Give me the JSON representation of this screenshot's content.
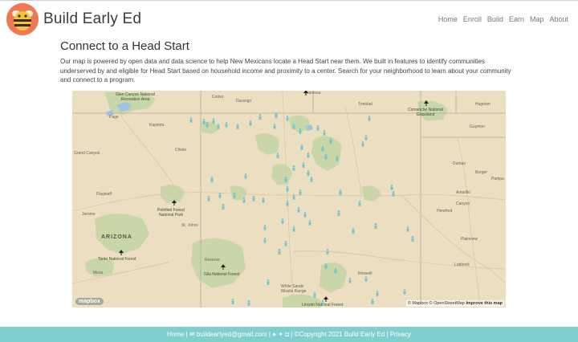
{
  "brand": {
    "name": "Build Early Ed"
  },
  "nav": [
    {
      "label": "Home"
    },
    {
      "label": "Enroll"
    },
    {
      "label": "Build"
    },
    {
      "label": "Earn"
    },
    {
      "label": "Map"
    },
    {
      "label": "About"
    }
  ],
  "main": {
    "title": "Connect to a Head Start",
    "intro": "Our map is powered by open data and data science to help New Mexicans locate a Head Start near them. We built in features to identify communities underserved by and eligible for Head Start based on household income and proximity to a center. Search for your neighborhood to learn about your community and connect to a program."
  },
  "map": {
    "state_label": "ARIZONA",
    "places": {
      "glen_canyon": "Glen Canyon National\nRecreation Area",
      "page": "Page",
      "kayenta": "Kayenta",
      "grand_canyon": "Grand Canyon",
      "chinle": "Chinle",
      "flagstaff": "Flagstaff",
      "jerome": "Jerome",
      "petrified_forest": "Petrified Forest\nNational Park",
      "st_johns": "St. Johns",
      "tonto": "Tonto National Forest",
      "mesa": "Mesa",
      "reserve": "Reserve",
      "gila": "Gila National Forest",
      "white_sands": "White Sands\nMissile Range",
      "lincoln": "Lincoln National Forest",
      "roswell": "Roswell",
      "cortez": "Cortez",
      "durango": "Durango",
      "trinidad": "Trinidad",
      "comanche": "Comanche National\nGrassland",
      "hugoton": "Hugoton",
      "guymon": "Guymon",
      "dumas": "Dumas",
      "borger": "Borger",
      "pampa": "Pampa",
      "amarillo": "Amarillo",
      "canyon": "Canyon",
      "hereford": "Hereford",
      "plainview": "Plainview",
      "lubbock": "Lubbock",
      "alamosa": "Alamosa"
    },
    "attribution": "© Mapbox © OpenStreetMap",
    "improve": "Improve this map",
    "logo": "mapbox",
    "pin_color": "#6cc3d3",
    "park_color": "#bcd4a0",
    "base_color": "#ecdfc1"
  },
  "footer": {
    "home": "Home",
    "email": "buildearlyed@gmail.com",
    "copyright": "©Copyright 2021 Build Early Ed",
    "privacy": "Privacy",
    "sep": "|"
  }
}
